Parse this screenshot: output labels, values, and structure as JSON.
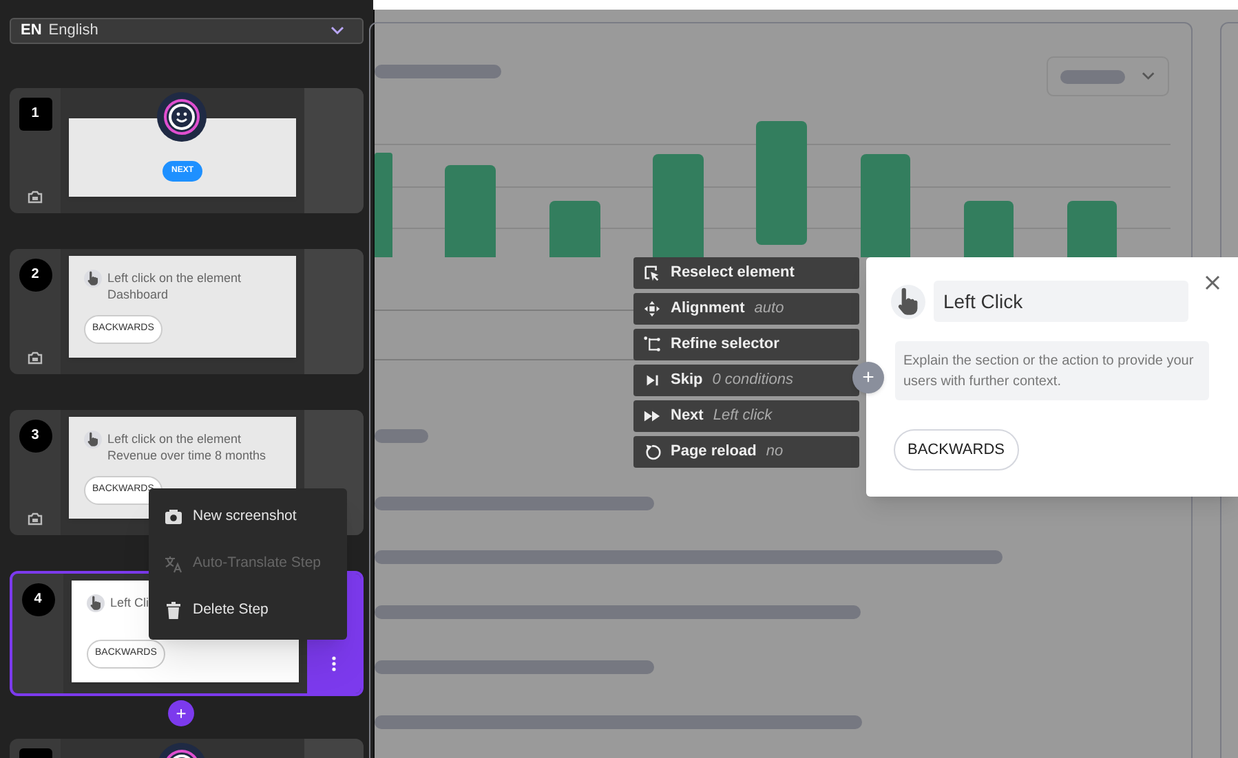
{
  "language": {
    "code": "EN",
    "name": "English"
  },
  "steps": [
    {
      "kind": "intro",
      "number": "1",
      "selected": false,
      "button": "NEXT"
    },
    {
      "kind": "action",
      "number": "2",
      "selected": false,
      "lines": [
        "Left click on the element",
        "Dashboard"
      ],
      "button": "BACKWARDS"
    },
    {
      "kind": "action",
      "number": "3",
      "selected": false,
      "lines": [
        "Left click on the element",
        "Revenue over time 8 months"
      ],
      "button": "BACKWARDS"
    },
    {
      "kind": "action",
      "number": "4",
      "selected": true,
      "lines": [
        "Left Cli"
      ],
      "button": "BACKWARDS"
    },
    {
      "kind": "intro",
      "selected": false
    }
  ],
  "add_step": "+",
  "context_menu": [
    {
      "kind": "camera",
      "label": "New screenshot",
      "disabled": false
    },
    {
      "kind": "translate",
      "label": "Auto-Translate Step",
      "disabled": true
    },
    {
      "kind": "trash",
      "label": "Delete Step",
      "disabled": false
    }
  ],
  "toolbar": [
    {
      "kind": "reselect",
      "label": "Reselect element"
    },
    {
      "kind": "alignment",
      "label": "Alignment",
      "value": "auto"
    },
    {
      "kind": "refine",
      "label": "Refine selector"
    },
    {
      "kind": "skip",
      "label": "Skip",
      "value": "0 conditions"
    },
    {
      "kind": "next",
      "label": "Next",
      "value": "Left click"
    },
    {
      "kind": "reload",
      "label": "Page reload",
      "value": "no"
    }
  ],
  "add_button": "+",
  "popover": {
    "title": "Left Click",
    "description_placeholder": "Explain the section or the action to provide your users with further context.",
    "button": "BACKWARDS"
  }
}
